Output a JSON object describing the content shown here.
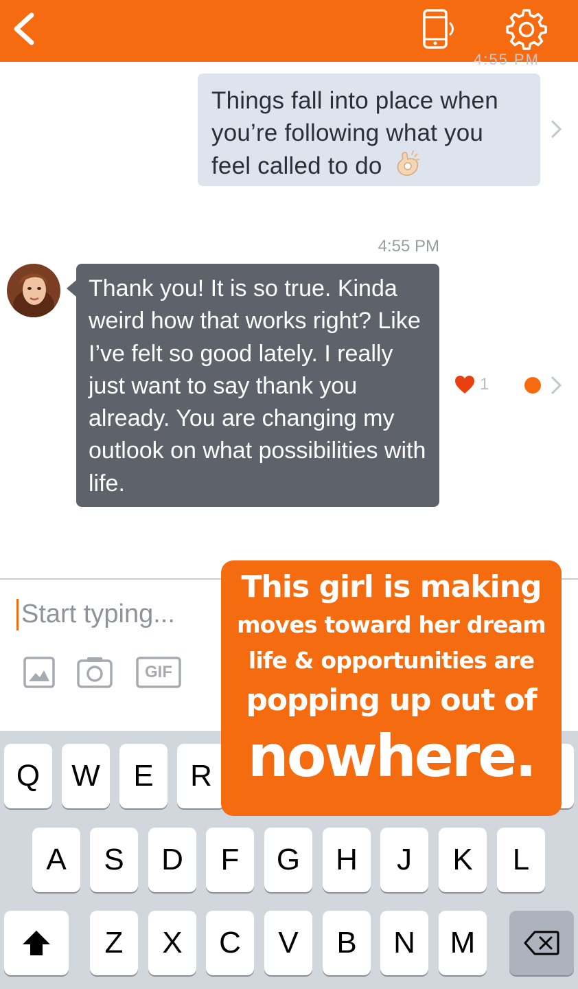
{
  "header": {
    "back_icon": "chevron-left-icon",
    "call_icon": "phone-vibrate-icon",
    "settings_icon": "gear-icon",
    "bg_color": "#f66b10"
  },
  "messages": {
    "cut_timestamp": "4:55 PM",
    "sent": {
      "text": "Things fall into place when you’re following what you feel called to do",
      "emoji": "ok-hand-emoji"
    },
    "timestamp": "4:55 PM",
    "received": {
      "text": "Thank you! It is so true. Kinda weird how that works right? Like I’ve felt so good lately. I really just want to say thank you already. You are changing my outlook on what possibilities with life.",
      "like_count": "1"
    }
  },
  "composer": {
    "placeholder": "Start typing...",
    "gif_label": "GIF"
  },
  "keyboard": {
    "row1": [
      "Q",
      "W",
      "E",
      "R"
    ],
    "row2": [
      "A",
      "S",
      "D",
      "F",
      "G",
      "H",
      "J",
      "K",
      "L"
    ],
    "row3": [
      "Z",
      "X",
      "C",
      "V",
      "B",
      "N",
      "M"
    ]
  },
  "overlay": {
    "line1": "This girl is making",
    "line2": "moves toward her dream",
    "line3": "life & opportunities are",
    "line4": "popping up out of",
    "line5": "nowhere.",
    "bg_color": "#f56b0f"
  }
}
